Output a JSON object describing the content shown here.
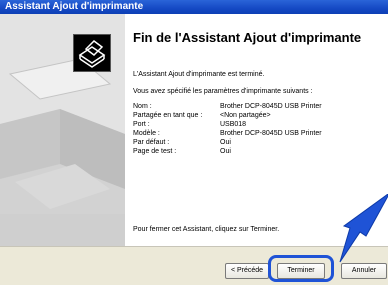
{
  "window": {
    "title": "Assistant Ajout d'imprimante"
  },
  "main": {
    "heading": "Fin de l'Assistant Ajout d'imprimante",
    "intro": "L'Assistant Ajout d'imprimante est terminé.",
    "specified": "Vous avez spécifié les paramètres d'imprimante suivants :",
    "settings": [
      {
        "label": "Nom :",
        "value": "Brother DCP-8045D USB Printer"
      },
      {
        "label": "Partagée en tant que :",
        "value": "<Non partagée>"
      },
      {
        "label": "Port :",
        "value": "USB018"
      },
      {
        "label": "Modèle :",
        "value": "Brother DCP-8045D USB Printer"
      },
      {
        "label": "Par défaut :",
        "value": "Oui"
      },
      {
        "label": "Page de test :",
        "value": "Oui"
      }
    ],
    "footer": "Pour fermer cet Assistant, cliquez sur Terminer."
  },
  "buttons": {
    "back": "< Précéde",
    "finish": "Terminer",
    "cancel": "Annuler"
  },
  "colors": {
    "titlebar": "#1549c4",
    "highlight": "#1f53d6",
    "arrow": "#1f53d6"
  }
}
